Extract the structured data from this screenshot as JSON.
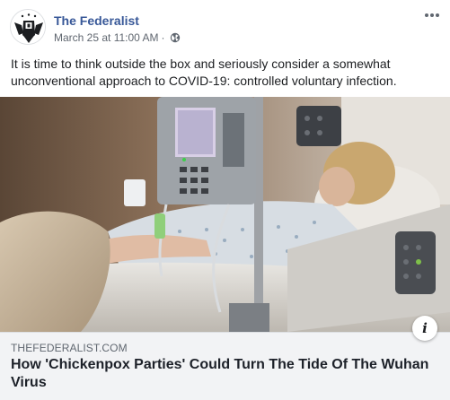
{
  "post": {
    "author": "The Federalist",
    "timestamp": "March 25 at 11:00 AM",
    "separator": "·",
    "audience_icon": "globe-icon",
    "more_icon": "more-options-icon",
    "text": "It is time to think outside the box and seriously consider a somewhat unconventional approach to COVID-19: controlled voluntary infection."
  },
  "link": {
    "domain": "THEFEDERALIST.COM",
    "title": "How 'Chickenpox Parties' Could Turn The Tide Of The Wuhan Virus",
    "info_label": "i"
  },
  "colors": {
    "author": "#385898",
    "meta": "#606770",
    "link_bg": "#f2f3f5"
  }
}
